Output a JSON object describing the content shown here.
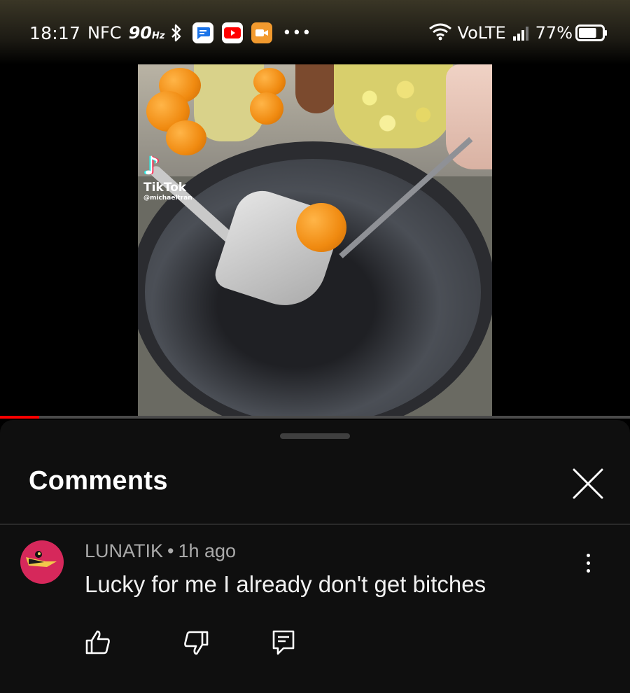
{
  "status_bar": {
    "time": "18:17",
    "nfc": "NFC",
    "refresh_rate": "90",
    "refresh_unit": "Hz",
    "network": "VoLTE",
    "battery_percent": "77%",
    "battery_level": 0.77,
    "icons": [
      "bluetooth-icon",
      "messages-app-icon",
      "youtube-app-icon",
      "screen-recorder-icon",
      "more-notifications-icon",
      "wifi-icon",
      "signal-icon",
      "battery-icon"
    ]
  },
  "video": {
    "watermark": "TikTok",
    "watermark_user": "@michaeltran",
    "progress": 0.062,
    "progress_color": "#ff0000"
  },
  "comments_panel": {
    "title": "Comments",
    "comments": [
      {
        "author": "LUNATIK",
        "separator": "•",
        "time_ago": "1h ago",
        "text": "Lucky for me I already don't get bitches",
        "avatar_color": "#d6285b"
      }
    ]
  }
}
